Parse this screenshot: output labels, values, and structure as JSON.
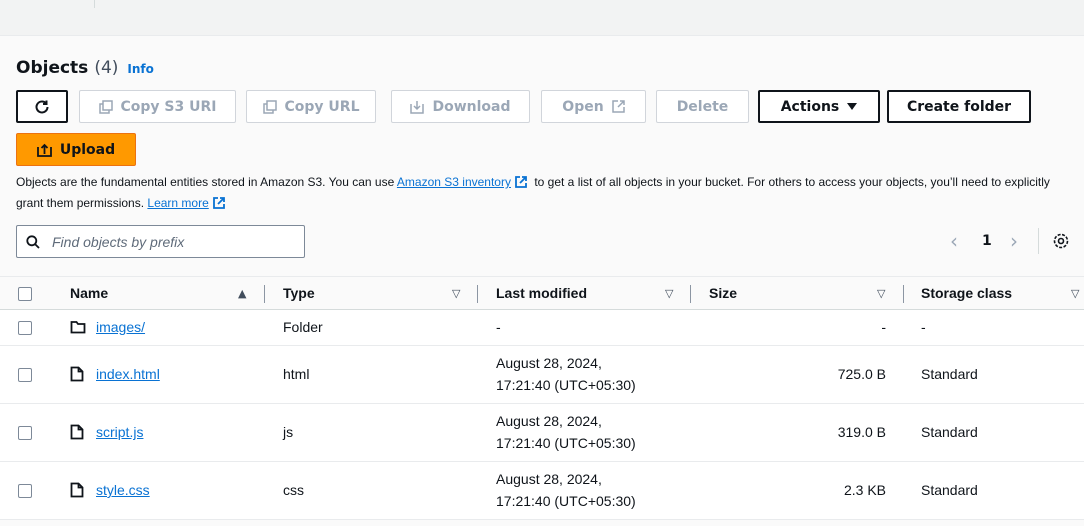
{
  "header": {
    "title": "Objects",
    "count": "(4)",
    "info": "Info"
  },
  "toolbar": {
    "refresh_icon": "refresh-icon",
    "copy_s3_uri": "Copy S3 URI",
    "copy_url": "Copy URL",
    "download": "Download",
    "open": "Open",
    "delete": "Delete",
    "actions": "Actions",
    "create_folder": "Create folder",
    "upload": "Upload",
    "upload_color": "#ff9900"
  },
  "description": {
    "part1": "Objects are the fundamental entities stored in Amazon S3. You can use",
    "link1": "Amazon S3 inventory",
    "part2": "to get a list of all objects in your bucket. For others to access your objects, you’ll need to explicitly grant them permissions.",
    "link2": "Learn more"
  },
  "search": {
    "placeholder": "Find objects by prefix",
    "value": ""
  },
  "pagination": {
    "prev": "‹",
    "page": "1",
    "next": "›"
  },
  "table": {
    "columns": {
      "name": "Name",
      "type": "Type",
      "last_modified": "Last modified",
      "size": "Size",
      "storage_class": "Storage class"
    },
    "rows": [
      {
        "name": "images/",
        "icon": "folder-icon",
        "type": "Folder",
        "modified_date": "-",
        "modified_time": "",
        "size": "-",
        "storage": "-"
      },
      {
        "name": "index.html",
        "icon": "file-icon",
        "type": "html",
        "modified_date": "August 28, 2024,",
        "modified_time": "17:21:40 (UTC+05:30)",
        "size": "725.0 B",
        "storage": "Standard"
      },
      {
        "name": "script.js",
        "icon": "file-icon",
        "type": "js",
        "modified_date": "August 28, 2024,",
        "modified_time": "17:21:40 (UTC+05:30)",
        "size": "319.0 B",
        "storage": "Standard"
      },
      {
        "name": "style.css",
        "icon": "file-icon",
        "type": "css",
        "modified_date": "August 28, 2024,",
        "modified_time": "17:21:40 (UTC+05:30)",
        "size": "2.3 KB",
        "storage": "Standard"
      }
    ]
  }
}
